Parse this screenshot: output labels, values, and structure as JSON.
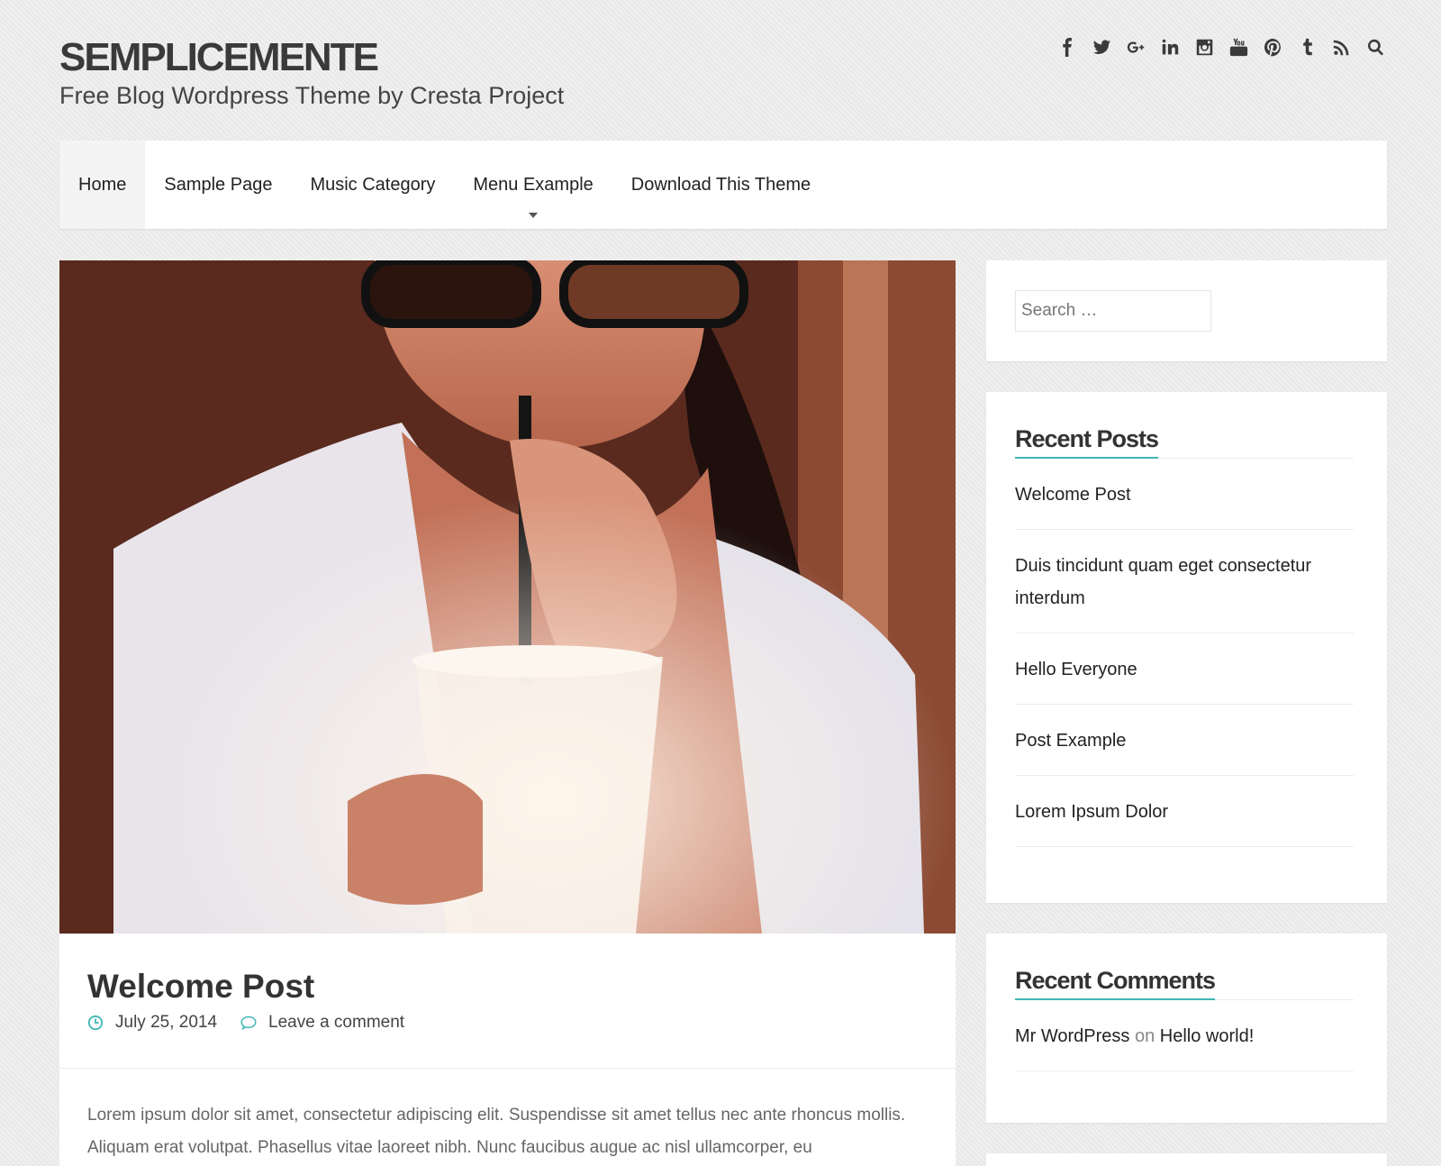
{
  "header": {
    "site_title": "SEMPLICEMENTE",
    "site_description": "Free Blog Wordpress Theme by Cresta Project",
    "social_icons": [
      "facebook-icon",
      "twitter-icon",
      "google-plus-icon",
      "linkedin-icon",
      "instagram-icon",
      "youtube-icon",
      "pinterest-icon",
      "tumblr-icon",
      "rss-icon",
      "search-icon"
    ]
  },
  "nav": {
    "items": [
      {
        "label": "Home"
      },
      {
        "label": "Sample Page"
      },
      {
        "label": "Music Category"
      },
      {
        "label": "Menu Example"
      },
      {
        "label": "Download This Theme"
      }
    ]
  },
  "post": {
    "title": "Welcome Post",
    "date": "July 25, 2014",
    "comments_link": "Leave a comment",
    "excerpt": "Lorem ipsum dolor sit amet, consectetur adipiscing elit. Suspendisse sit amet tellus nec ante rhoncus mollis. Aliquam erat volutpat. Phasellus vitae laoreet nibh. Nunc faucibus augue ac nisl ullamcorper, eu"
  },
  "sidebar": {
    "search_placeholder": "Search …",
    "recent_posts": {
      "title": "Recent Posts",
      "items": [
        "Welcome Post",
        "Duis tincidunt quam eget consectetur interdum",
        "Hello Everyone",
        "Post Example",
        "Lorem Ipsum Dolor"
      ]
    },
    "recent_comments": {
      "title": "Recent Comments",
      "author": "Mr WordPress",
      "on": "on",
      "post": "Hello world!"
    }
  },
  "colors": {
    "accent": "#3eb6b4",
    "background": "#ebebeb"
  }
}
